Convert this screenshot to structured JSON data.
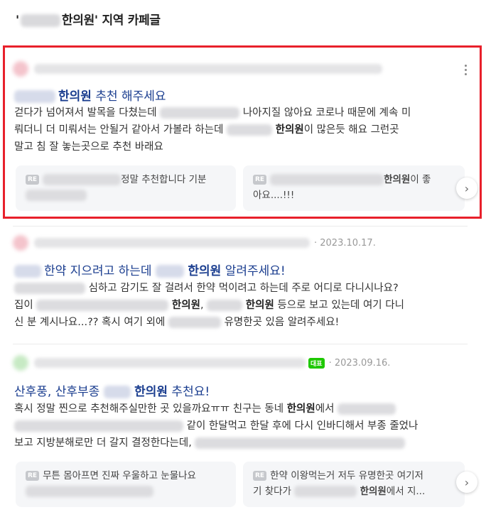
{
  "section": {
    "title_prefix": "'",
    "title_suffix": "한의원' 지역 카페글"
  },
  "posts": [
    {
      "date": "",
      "title": {
        "after": "한의원",
        "rest": " 추천 해주세요"
      },
      "body": {
        "l1a": "걷다가 넘어져서 발목을 다쳤는데",
        "l1b": "나아지질 않아요 코로나 때문에 계속 미",
        "l2a": "뤄더니 더 미뤄서는 안될거 같아서 가볼라 하는데",
        "l2b": "한의원",
        "l2c": "이 많은듯 해요 그런곳",
        "l3": "말고 침 잘 놓는곳으로 추천 바래요"
      },
      "replies": [
        {
          "badge": "RE",
          "t1": "정말 추천합니다 기분"
        },
        {
          "badge": "RE",
          "bold": "한의원",
          "t1": "이 좋",
          "t2": "아요....!!!"
        }
      ]
    },
    {
      "date": "· 2023.10.17.",
      "title": {
        "a": "한약 지으려고 하는데",
        "b": "한의원",
        "c": " 알려주세요!"
      },
      "body": {
        "l1": "심하고 감기도 잘 걸려서 한약 먹이려고 하는데 주로 어디로 다니시나요?",
        "l2a": "집이",
        "l2b": "한의원",
        "l2c": ",",
        "l2d": "한의원",
        "l2e": " 등으로 보고 있는데 여기 다니",
        "l3a": "신 분 계시나요...?? 혹시 여기 외에",
        "l3b": "유명한곳 있음 알려주세요!"
      }
    },
    {
      "badge": "대표",
      "date": "· 2023.09.16.",
      "title": {
        "a": "산후풍, 산후부종",
        "b": "한의원",
        "c": " 추천요!"
      },
      "body": {
        "l1a": "혹시 정말 찐으로 추천해주실만한 곳 있을까요ㅠㅠ 친구는 동네",
        "l1b": "한의원",
        "l1c": "에서",
        "l2": "같이 한달먹고 한달 후에 다시 인바디해서 부종 줄었나",
        "l3": "보고 지방분해로만 더 갈지 결정한다는데,"
      },
      "replies": [
        {
          "badge": "RE",
          "t1": "무튼 몸아프면 진짜 우울하고 눈물나요"
        },
        {
          "badge": "RE",
          "t1": "한약 이왕먹는거 저두 유명한곳 여기저",
          "t2": "기 찾다가",
          "bold": "한의원",
          "t3": "에서 지..."
        }
      ]
    }
  ],
  "icons": {
    "more": "more-vertical-icon",
    "next": "chevron-right-icon",
    "next_glyph": "›"
  }
}
